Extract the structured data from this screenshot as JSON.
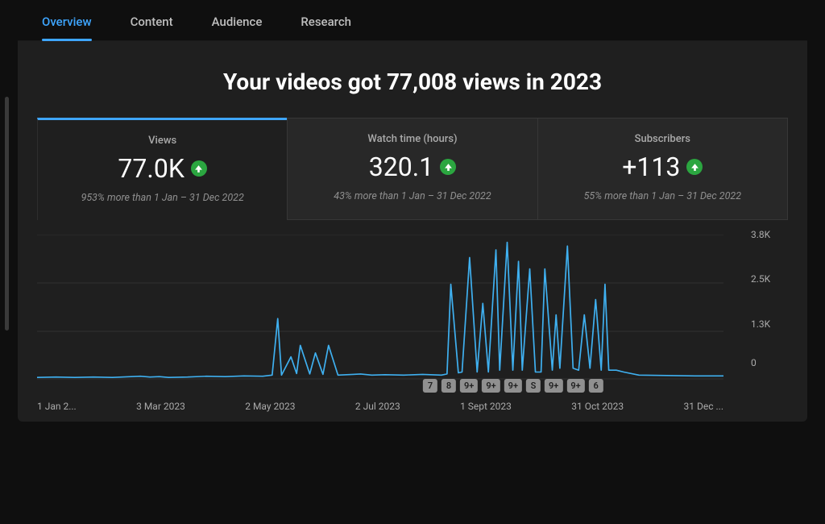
{
  "tabs": [
    {
      "label": "Overview",
      "active": true
    },
    {
      "label": "Content",
      "active": false
    },
    {
      "label": "Audience",
      "active": false
    },
    {
      "label": "Research",
      "active": false
    }
  ],
  "headline": "Your videos got 77,008 views in 2023",
  "metrics": [
    {
      "title": "Views",
      "value": "77.0K",
      "delta": "953% more than 1 Jan – 31 Dec 2022",
      "active": true
    },
    {
      "title": "Watch time (hours)",
      "value": "320.1",
      "delta": "43% more than 1 Jan – 31 Dec 2022",
      "active": false
    },
    {
      "title": "Subscribers",
      "value": "+113",
      "delta": "55% more than 1 Jan – 31 Dec 2022",
      "active": false
    }
  ],
  "markers": [
    "7",
    "8",
    "9+",
    "9+",
    "9+",
    "S",
    "9+",
    "9+",
    "6"
  ],
  "chart_data": {
    "type": "line",
    "title": "Views over time (2023)",
    "xlabel": "",
    "ylabel": "Views",
    "ylim": [
      0,
      3800
    ],
    "y_ticks": [
      "3.8K",
      "2.5K",
      "1.3K",
      "0"
    ],
    "x_ticks": [
      "1 Jan 2...",
      "3 Mar 2023",
      "2 May 2023",
      "2 Jul 2023",
      "1 Sept 2023",
      "31 Oct 2023",
      "31 Dec ..."
    ],
    "x": [
      0,
      10,
      20,
      30,
      40,
      50,
      55,
      60,
      65,
      70,
      80,
      90,
      100,
      110,
      120,
      125,
      128,
      130,
      135,
      138,
      140,
      145,
      148,
      152,
      155,
      160,
      168,
      172,
      178,
      185,
      195,
      205,
      215,
      218,
      220,
      224,
      226,
      230,
      234,
      237,
      240,
      244,
      246,
      250,
      253,
      256,
      258,
      262,
      265,
      268,
      270,
      274,
      276,
      278,
      282,
      285,
      288,
      291,
      294,
      297,
      300,
      302,
      304,
      308,
      312,
      320,
      335,
      350,
      365
    ],
    "values": [
      60,
      70,
      60,
      70,
      60,
      80,
      90,
      70,
      80,
      60,
      70,
      90,
      80,
      100,
      90,
      120,
      1600,
      120,
      600,
      160,
      900,
      150,
      700,
      140,
      900,
      120,
      140,
      150,
      120,
      130,
      120,
      140,
      120,
      150,
      2500,
      180,
      200,
      3200,
      200,
      2000,
      200,
      3400,
      250,
      3600,
      250,
      3100,
      250,
      2900,
      200,
      200,
      2900,
      250,
      1700,
      300,
      3500,
      300,
      250,
      1700,
      300,
      2100,
      250,
      2500,
      250,
      250,
      200,
      120,
      110,
      100,
      100
    ]
  }
}
